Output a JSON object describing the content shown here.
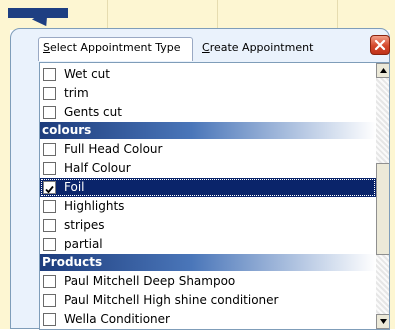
{
  "tabs": {
    "select_label": "Select Appointment Type",
    "create_label": "Create Appointment"
  },
  "list": {
    "items": [
      {
        "type": "item",
        "label": "Wet cut",
        "checked": false
      },
      {
        "type": "item",
        "label": "trim",
        "checked": false
      },
      {
        "type": "item",
        "label": "Gents cut",
        "checked": false
      },
      {
        "type": "header",
        "label": "colours"
      },
      {
        "type": "item",
        "label": "Full Head Colour",
        "checked": false
      },
      {
        "type": "item",
        "label": "Half Colour",
        "checked": false
      },
      {
        "type": "item",
        "label": "Foil",
        "checked": true,
        "selected": true
      },
      {
        "type": "item",
        "label": "Highlights",
        "checked": false
      },
      {
        "type": "item",
        "label": "stripes",
        "checked": false
      },
      {
        "type": "item",
        "label": "partial",
        "checked": false
      },
      {
        "type": "header",
        "label": "Products"
      },
      {
        "type": "item",
        "label": "Paul Mitchell Deep Shampoo",
        "checked": false
      },
      {
        "type": "item",
        "label": "Paul Mitchell High shine conditioner",
        "checked": false
      },
      {
        "type": "item",
        "label": "Wella Conditioner",
        "checked": false
      }
    ]
  },
  "icons": {
    "close": "close-icon",
    "scroll_up": "arrow-up-icon",
    "scroll_down": "arrow-down-icon",
    "check": "check-icon"
  },
  "colors": {
    "selection": "#0a246a",
    "header_start": "#1d3c7c",
    "close_button": "#d4472b"
  }
}
